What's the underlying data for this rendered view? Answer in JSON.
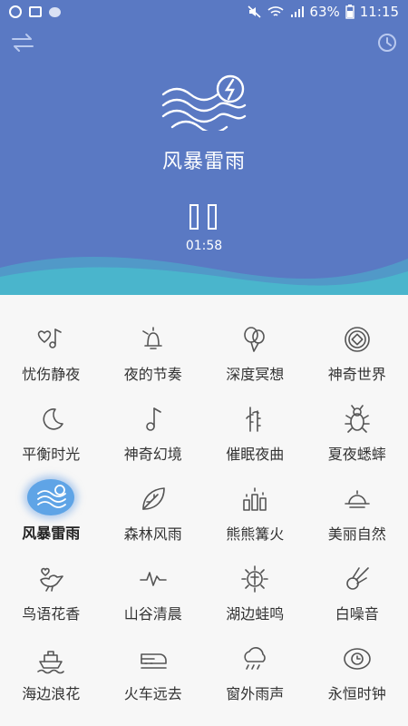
{
  "status": {
    "battery": "63%",
    "time": "11:15"
  },
  "player": {
    "title": "风暴雷雨",
    "elapsed": "01:58"
  },
  "sounds": [
    {
      "label": "忧伤静夜",
      "icon": "heart-note-icon"
    },
    {
      "label": "夜的节奏",
      "icon": "bell-icon"
    },
    {
      "label": "深度冥想",
      "icon": "balloons-icon"
    },
    {
      "label": "神奇世界",
      "icon": "coin-icon"
    },
    {
      "label": "平衡时光",
      "icon": "moon-icon"
    },
    {
      "label": "神奇幻境",
      "icon": "music-note-icon"
    },
    {
      "label": "催眠夜曲",
      "icon": "bamboo-icon"
    },
    {
      "label": "夏夜蟋蟀",
      "icon": "bug-icon"
    },
    {
      "label": "风暴雷雨",
      "icon": "storm-wave-icon",
      "active": true
    },
    {
      "label": "森林风雨",
      "icon": "leaf-icon"
    },
    {
      "label": "熊熊篝火",
      "icon": "candles-icon"
    },
    {
      "label": "美丽自然",
      "icon": "sunset-icon"
    },
    {
      "label": "鸟语花香",
      "icon": "bird-icon"
    },
    {
      "label": "山谷清晨",
      "icon": "pulse-icon"
    },
    {
      "label": "湖边蛙鸣",
      "icon": "sun-icon"
    },
    {
      "label": "白噪音",
      "icon": "comet-icon"
    },
    {
      "label": "海边浪花",
      "icon": "ship-icon"
    },
    {
      "label": "火车远去",
      "icon": "train-icon"
    },
    {
      "label": "窗外雨声",
      "icon": "rain-cloud-icon"
    },
    {
      "label": "永恒时钟",
      "icon": "clock-orbit-icon"
    }
  ],
  "colors": {
    "hero": "#5a79c3",
    "wave": "#4ab5cc",
    "active": "#5fa4e6"
  }
}
